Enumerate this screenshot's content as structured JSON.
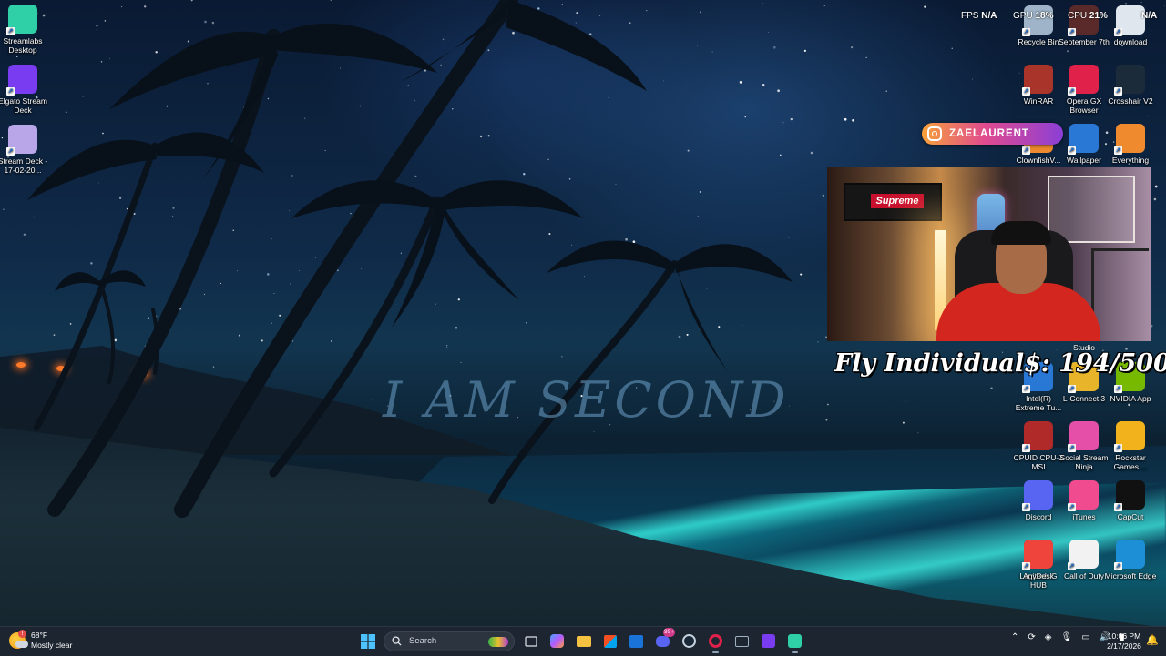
{
  "wallpaper": {
    "text": "I AM SECOND"
  },
  "perf": {
    "fps_label": "FPS",
    "fps_value": "N/A",
    "gpu_label": "GPU",
    "gpu_value": "18%",
    "cpu_label": "CPU",
    "cpu_value": "21%",
    "ram_value": "N/A"
  },
  "desktop_icons_left": [
    {
      "label": "Streamlabs Desktop",
      "icon": "streamlabs-icon",
      "color": "#2fd0a8"
    },
    {
      "label": "Elgato Stream Deck",
      "icon": "stream-deck-icon",
      "color": "#7a3cf0"
    },
    {
      "label": "Stream Deck - 17-02-20...",
      "icon": "database-file-icon",
      "color": "#b9a6e8"
    }
  ],
  "desktop_icons_right": [
    {
      "label": "Recycle Bin",
      "icon": "recycle-bin-icon",
      "color": "#9fb4c8"
    },
    {
      "label": "September 7th",
      "icon": "video-file-icon",
      "color": "#5a2a2a"
    },
    {
      "label": "download",
      "icon": "image-file-icon",
      "color": "#dfe6ee"
    },
    {
      "label": "WinRAR",
      "icon": "winrar-icon",
      "color": "#a8342a"
    },
    {
      "label": "Opera GX Browser",
      "icon": "opera-gx-icon",
      "color": "#e0214a"
    },
    {
      "label": "Crosshair V2",
      "icon": "crosshair-icon",
      "color": "#1c2b3a"
    },
    {
      "label": "ClownfishV...",
      "icon": "clownfish-icon",
      "color": "#f08a2e"
    },
    {
      "label": "Wallpaper",
      "icon": "wallpaper-engine-icon",
      "color": "#2a78d6"
    },
    {
      "label": "Everything",
      "icon": "everything-search-icon",
      "color": "#f08a2e"
    },
    {
      "label": "Intel(R) Extreme Tu...",
      "icon": "intel-xtu-icon",
      "color": "#2a78d6"
    },
    {
      "label": "L-Connect 3",
      "icon": "l-connect-icon",
      "color": "#e8b42a"
    },
    {
      "label": "NVIDIA App",
      "icon": "nvidia-icon",
      "color": "#76b900"
    },
    {
      "label": "CPUID CPU-Z MSI",
      "icon": "cpuz-icon",
      "color": "#b02a2a"
    },
    {
      "label": "Social Stream Ninja",
      "icon": "social-stream-icon",
      "color": "#e54fa7"
    },
    {
      "label": "Rockstar Games ...",
      "icon": "rockstar-icon",
      "color": "#f2b21b"
    },
    {
      "label": "Discord",
      "icon": "discord-icon",
      "color": "#5865f2"
    },
    {
      "label": "iTunes",
      "icon": "itunes-icon",
      "color": "#f04b8f"
    },
    {
      "label": "CapCut",
      "icon": "capcut-icon",
      "color": "#111111"
    },
    {
      "label": "Logitech G HUB",
      "icon": "logitech-icon",
      "color": "#0e0e0e"
    },
    {
      "label": "Call of Duty",
      "icon": "document-icon",
      "color": "#f2f2f2"
    },
    {
      "label": "Microsoft Edge",
      "icon": "edge-icon",
      "color": "#1c8fd6"
    },
    {
      "label": "AnyDesk",
      "icon": "anydesk-icon",
      "color": "#ef443b"
    }
  ],
  "overlay": {
    "instagram_handle": "ZAELAURENT",
    "webcam_sign": "Supreme",
    "studio_label": "Studio",
    "goal_label": "Fly Individual$:",
    "goal_value": "194/500"
  },
  "taskbar": {
    "weather_temp": "68°F",
    "weather_desc": "Mostly clear",
    "weather_alert": "!",
    "search_placeholder": "Search",
    "discord_badge": "99+",
    "time": "10:06 PM",
    "date": "2/17/2026"
  }
}
